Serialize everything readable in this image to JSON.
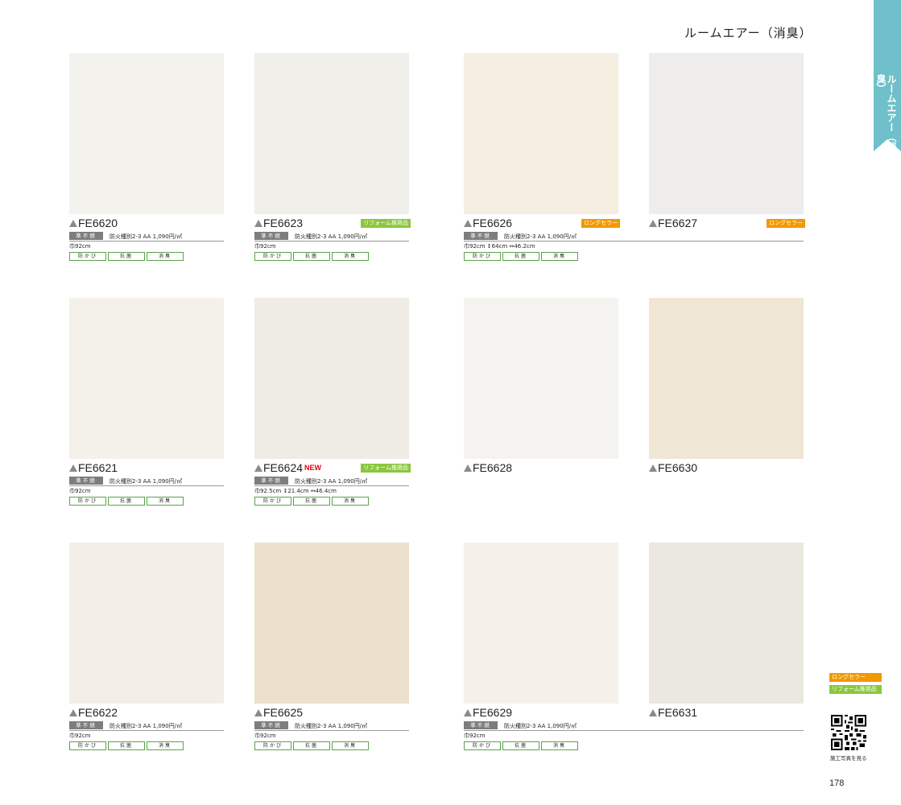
{
  "page": {
    "title": "ルームエアー（消臭）",
    "side_tab": "ルームエアー（消臭）",
    "page_number": "178"
  },
  "labels": {
    "fire_badge": "準不燃",
    "fire_text": "防火種別2-3",
    "price": "AA 1,090円/㎡",
    "features": [
      "防かび",
      "抗菌",
      "消臭"
    ]
  },
  "products": [
    {
      "code": "FE6620",
      "size": "巾92cm",
      "badge": "",
      "new": "",
      "swatch_color": "#f4f2ed"
    },
    {
      "code": "FE6623",
      "size": "巾92cm",
      "badge": "リフォーム推奨品",
      "new": "",
      "swatch_color": "#f1efea"
    },
    {
      "code": "FE6626",
      "size": "巾92cm ↕64cm ↔46.2cm",
      "badge": "ロングセラー",
      "new": "",
      "swatch_color": "#f5efe2"
    },
    {
      "code": "FE6627",
      "size": "",
      "badge": "ロングセラー",
      "new": "",
      "swatch_color": "#efedeb"
    },
    {
      "code": "FE6621",
      "size": "巾92cm",
      "badge": "",
      "new": "",
      "swatch_color": "#f4f1ea"
    },
    {
      "code": "FE6624",
      "size": "巾92.5cm ↕21.4cm ↔46.4cm",
      "badge": "リフォーム推奨品",
      "new": "NEW",
      "swatch_color": "#efece6"
    },
    {
      "code": "FE6628",
      "size": "",
      "badge": "",
      "new": "",
      "swatch_color": "#f5f3ef"
    },
    {
      "code": "FE6630",
      "size": "",
      "badge": "",
      "new": "",
      "swatch_color": "#f0e6d4"
    },
    {
      "code": "FE6622",
      "size": "巾92cm",
      "badge": "",
      "new": "",
      "swatch_color": "#f3efe7"
    },
    {
      "code": "FE6625",
      "size": "巾92cm",
      "badge": "",
      "new": "",
      "swatch_color": "#ece1cc"
    },
    {
      "code": "FE6629",
      "size": "巾92cm",
      "badge": "",
      "new": "",
      "swatch_color": "#f5f0e8"
    },
    {
      "code": "FE6631",
      "size": "",
      "badge": "",
      "new": "",
      "swatch_color": "#eae8df"
    }
  ],
  "legend": {
    "long_seller": "ロングセラー",
    "reform": "リフォーム推奨品"
  },
  "qr_caption": "施工写真を見る",
  "colors": {
    "tab": "#6fc0ca",
    "long_seller": "#f39800",
    "reform": "#8cc63f",
    "fire_badge": "#7d7d7d",
    "new": "#e60012"
  }
}
